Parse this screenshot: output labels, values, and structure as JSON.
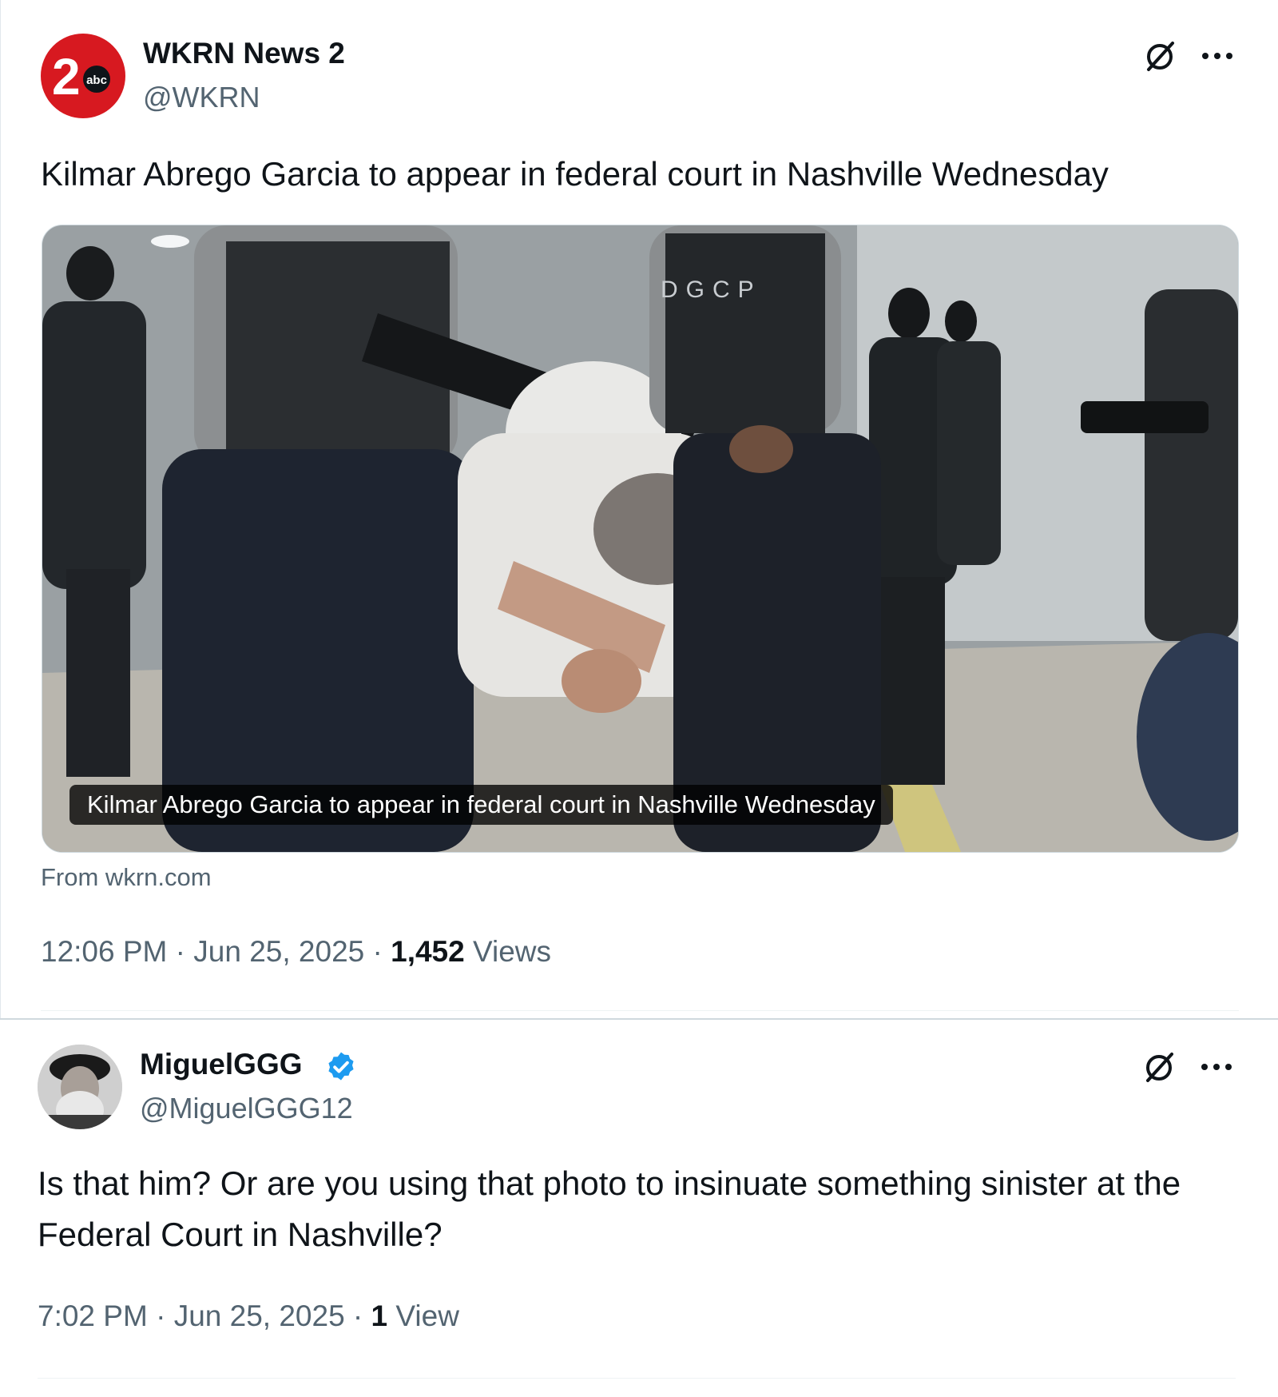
{
  "tweets": [
    {
      "author_name": "WKRN News 2",
      "author_handle": "@WKRN",
      "avatar_label": "2",
      "avatar_badge": "abc",
      "text": "Kilmar Abrego Garcia to appear in federal court in Nashville Wednesday",
      "card": {
        "caption": "Kilmar Abrego Garcia to appear in federal court in Nashville Wednesday",
        "image_text": "DGCP",
        "source": "From wkrn.com"
      },
      "time": "12:06 PM",
      "date": "Jun 25, 2025",
      "views_count": "1,452",
      "views_label": "Views"
    },
    {
      "author_name": "MiguelGGG",
      "author_handle": "@MiguelGGG12",
      "verified": true,
      "text": "Is that him? Or are you using that photo to insinuate something sinister at the Federal Court in Nashville?",
      "time": "7:02 PM",
      "date": "Jun 25, 2025",
      "views_count": "1",
      "views_label": "View"
    }
  ],
  "separator": " · ",
  "icons": {
    "grok": "grok-icon",
    "more": "more-options-icon",
    "verified": "verified-badge-icon"
  },
  "colors": {
    "avatar_red": "#d71920",
    "verified_blue": "#1d9bf0",
    "secondary_text": "#536471"
  }
}
